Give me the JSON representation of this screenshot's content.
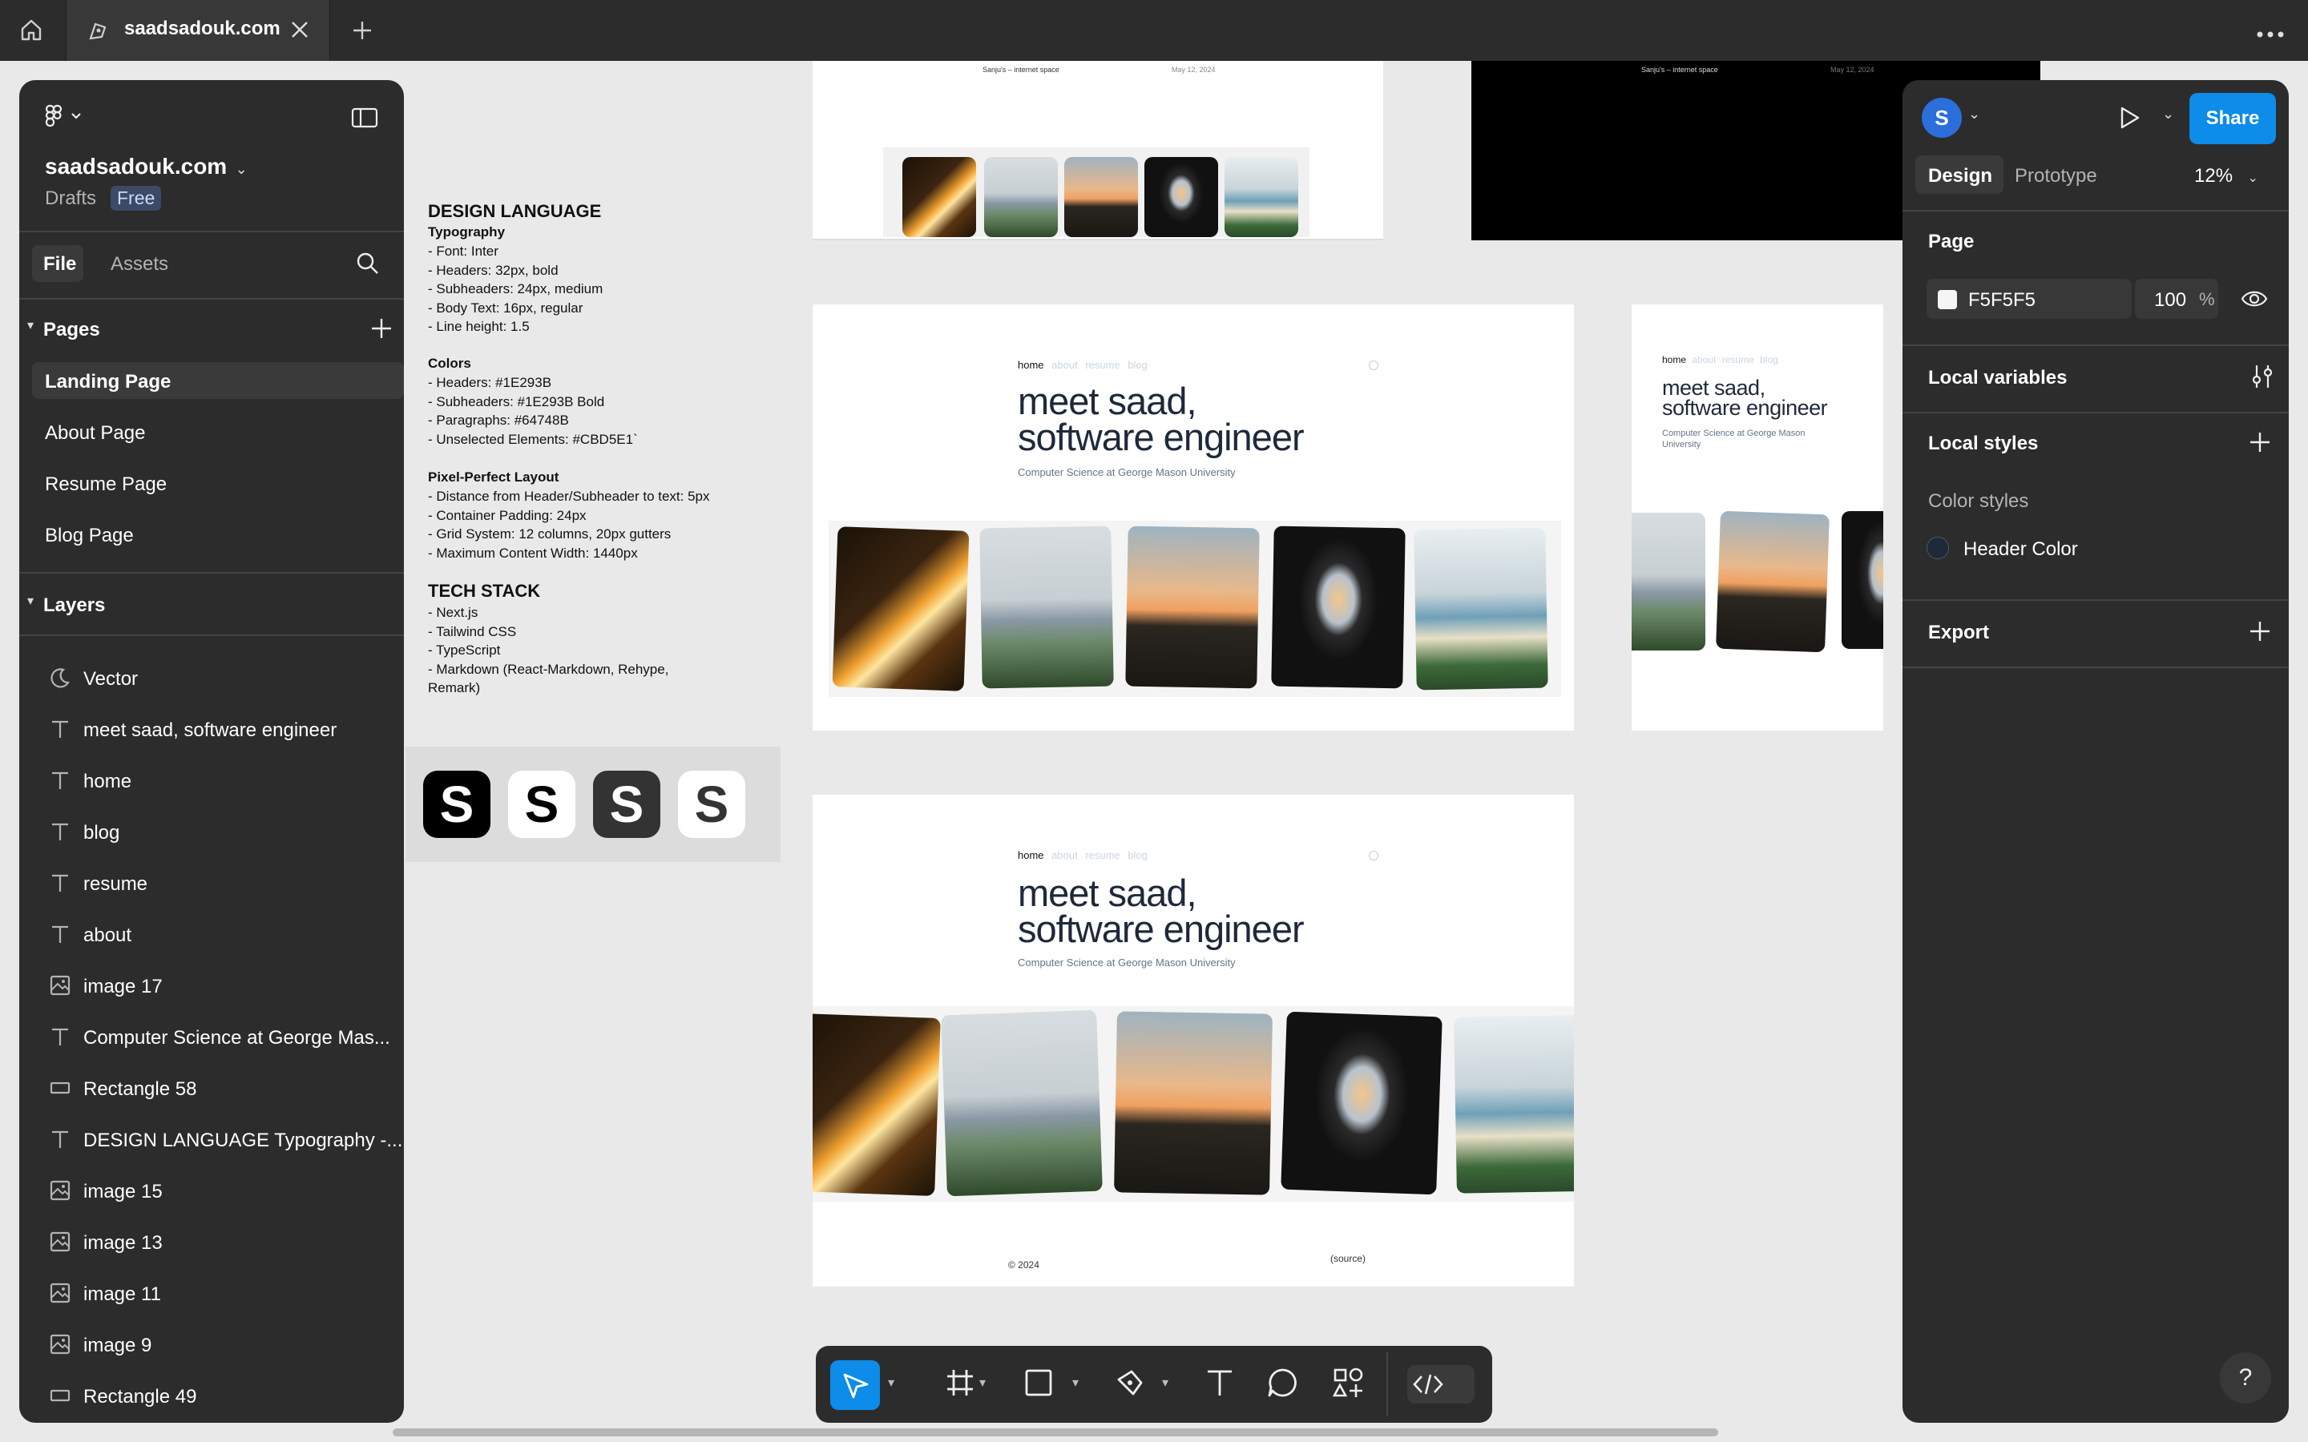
{
  "browser": {
    "tab_title": "saadsadouk.com",
    "home_icon": "home-icon",
    "new_tab_icon": "plus-icon",
    "more_icon": "more-icon"
  },
  "left_panel": {
    "file_name": "saadsadouk.com",
    "drafts_label": "Drafts",
    "plan_badge": "Free",
    "tabs": [
      "File",
      "Assets"
    ],
    "pages_title": "Pages",
    "pages": [
      "Landing Page",
      "About Page",
      "Resume Page",
      "Blog Page"
    ],
    "selected_page": "Landing Page",
    "layers_title": "Layers",
    "layers": [
      {
        "name": "Vector",
        "icon": "vector-icon"
      },
      {
        "name": "meet saad, software engineer",
        "icon": "text-icon"
      },
      {
        "name": "home",
        "icon": "text-icon"
      },
      {
        "name": "blog",
        "icon": "text-icon"
      },
      {
        "name": "resume",
        "icon": "text-icon"
      },
      {
        "name": "about",
        "icon": "text-icon"
      },
      {
        "name": "image 17",
        "icon": "image-icon"
      },
      {
        "name": "Computer Science at George Mas...",
        "icon": "text-icon"
      },
      {
        "name": "Rectangle 58",
        "icon": "rectangle-icon"
      },
      {
        "name": "DESIGN LANGUAGE Typography -...",
        "icon": "text-icon"
      },
      {
        "name": "image 15",
        "icon": "image-icon"
      },
      {
        "name": "image 13",
        "icon": "image-icon"
      },
      {
        "name": "image 11",
        "icon": "image-icon"
      },
      {
        "name": "image 9",
        "icon": "image-icon"
      },
      {
        "name": "Rectangle 49",
        "icon": "rectangle-icon"
      }
    ]
  },
  "right_panel": {
    "avatar_letter": "S",
    "share_label": "Share",
    "tabs": [
      "Design",
      "Prototype"
    ],
    "zoom": "12%",
    "page_section": "Page",
    "page_color": "F5F5F5",
    "page_opacity": "100",
    "percent": "%",
    "local_variables": "Local variables",
    "local_styles": "Local styles",
    "color_styles": "Color styles",
    "header_color_name": "Header Color",
    "header_color": "#1E293B",
    "export": "Export",
    "help": "?"
  },
  "canvas": {
    "design_doc": {
      "title": "DESIGN LANGUAGE",
      "typography_title": "Typography",
      "typography_lines": "- Font: Inter\n- Headers: 32px, bold\n- Subheaders: 24px, medium\n- Body Text: 16px, regular\n- Line height: 1.5",
      "colors_title": "Colors",
      "colors_lines": "- Headers: #1E293B\n- Subheaders: #1E293B Bold\n- Paragraphs: #64748B\n- Unselected Elements: #CBD5E1`",
      "layout_title": "Pixel-Perfect Layout",
      "layout_lines": "- Distance from Header/Subheader to text: 5px\n- Container Padding: 24px\n- Grid System: 12 columns, 20px gutters\n- Maximum Content Width: 1440px",
      "stack_title": "TECH STACK",
      "stack_lines": "- Next.js\n- Tailwind CSS\n- TypeScript\n- Markdown (React-Markdown, Rehype,\nRemark)"
    },
    "logo_variants": [
      "S",
      "S",
      "S",
      "S"
    ],
    "site": {
      "nav": [
        "home",
        "about",
        "resume",
        "blog"
      ],
      "headline_line1": "meet saad,",
      "headline_line2": "software engineer",
      "subtitle": "Computer Science at George Mason University",
      "footer_year": "© 2024",
      "footer_source": "(source)",
      "blog_meta_left": "Sanju's – internet space",
      "blog_meta_right": "May 12, 2024"
    }
  },
  "toolbar": {
    "tools": [
      "move-tool",
      "frame-tool",
      "rectangle-tool",
      "pen-tool",
      "text-tool",
      "comment-tool",
      "components-tool",
      "dev-mode-toggle"
    ]
  }
}
